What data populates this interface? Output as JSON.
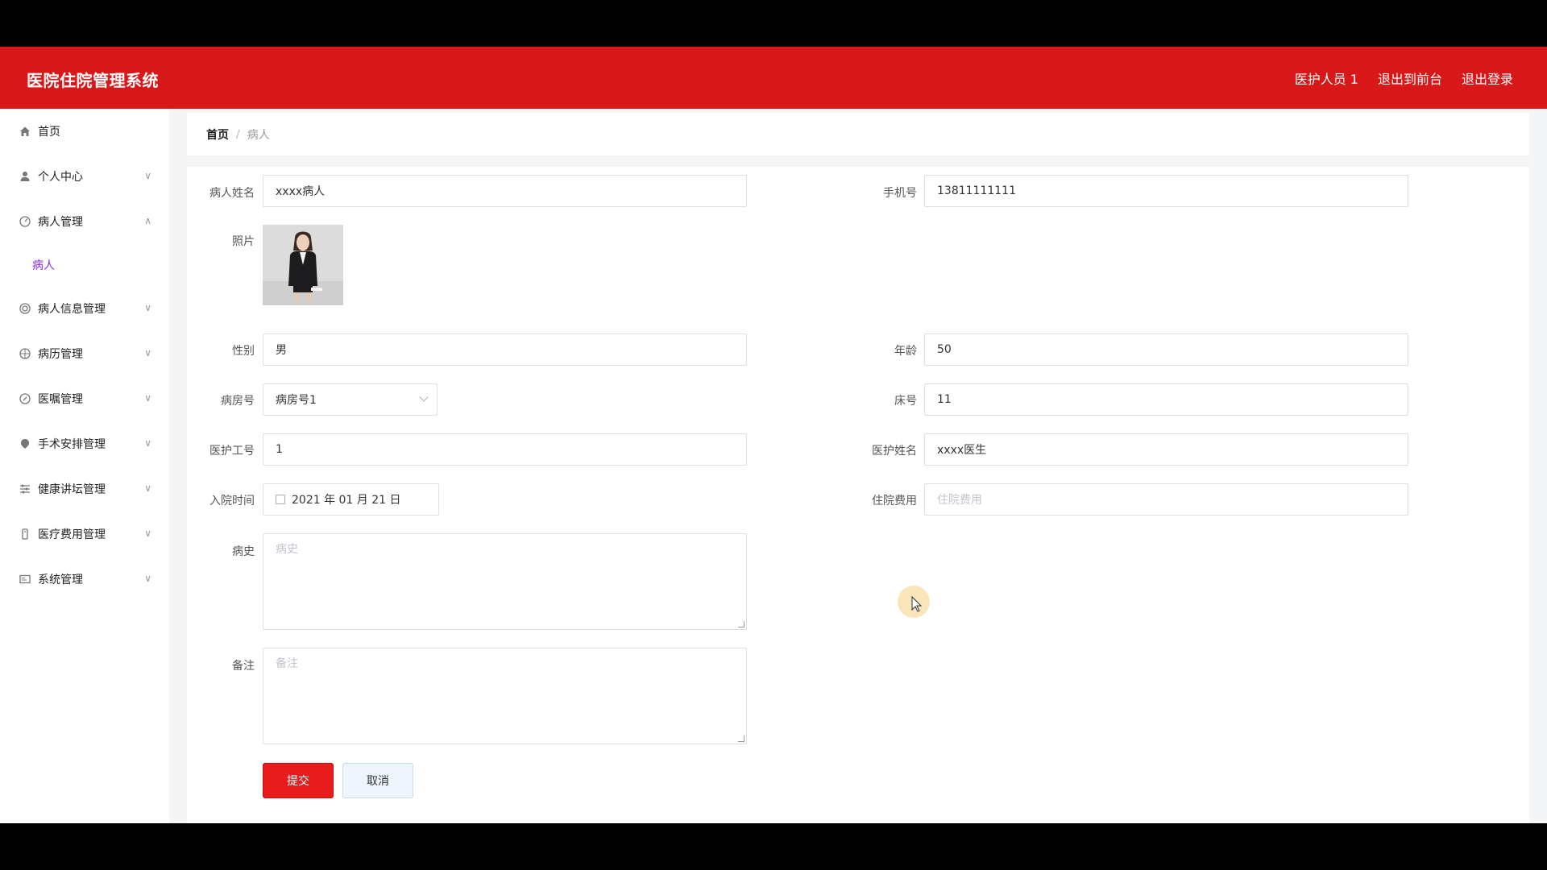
{
  "header": {
    "title": "医院住院管理系统",
    "links": [
      "医护人员 1",
      "退出到前台",
      "退出登录"
    ]
  },
  "sidebar": {
    "items": [
      {
        "label": "首页",
        "icon": "home-icon"
      },
      {
        "label": "个人中心",
        "icon": "user-icon"
      },
      {
        "label": "病人管理",
        "icon": "patient-mgmt-icon",
        "expanded": true,
        "children": [
          {
            "label": "病人"
          }
        ]
      },
      {
        "label": "病人信息管理",
        "icon": "info-icon"
      },
      {
        "label": "病历管理",
        "icon": "record-icon"
      },
      {
        "label": "医嘱管理",
        "icon": "order-icon"
      },
      {
        "label": "手术安排管理",
        "icon": "surgery-icon"
      },
      {
        "label": "健康讲坛管理",
        "icon": "lecture-icon"
      },
      {
        "label": "医疗费用管理",
        "icon": "fee-icon"
      },
      {
        "label": "系统管理",
        "icon": "system-icon"
      }
    ]
  },
  "breadcrumb": {
    "home": "首页",
    "sep": "/",
    "current": "病人"
  },
  "form": {
    "patient_name": {
      "label": "病人姓名",
      "value": "xxxx病人"
    },
    "phone": {
      "label": "手机号",
      "value": "13811111111"
    },
    "photo": {
      "label": "照片"
    },
    "gender": {
      "label": "性别",
      "value": "男"
    },
    "age": {
      "label": "年龄",
      "value": "50"
    },
    "room": {
      "label": "病房号",
      "value": "病房号1"
    },
    "bed": {
      "label": "床号",
      "value": "11"
    },
    "staff_id": {
      "label": "医护工号",
      "value": "1"
    },
    "staff_name": {
      "label": "医护姓名",
      "value": "xxxx医生"
    },
    "admit_date": {
      "label": "入院时间",
      "value": "2021 年 01 月 21 日"
    },
    "fee": {
      "label": "住院费用",
      "placeholder": "住院费用"
    },
    "history": {
      "label": "病史",
      "placeholder": "病史"
    },
    "remark": {
      "label": "备注",
      "placeholder": "备注"
    },
    "submit_label": "提交",
    "cancel_label": "取消"
  },
  "colors": {
    "header": "#d81818",
    "submit": "#e81c1c",
    "submenu": "#8a2be2"
  }
}
